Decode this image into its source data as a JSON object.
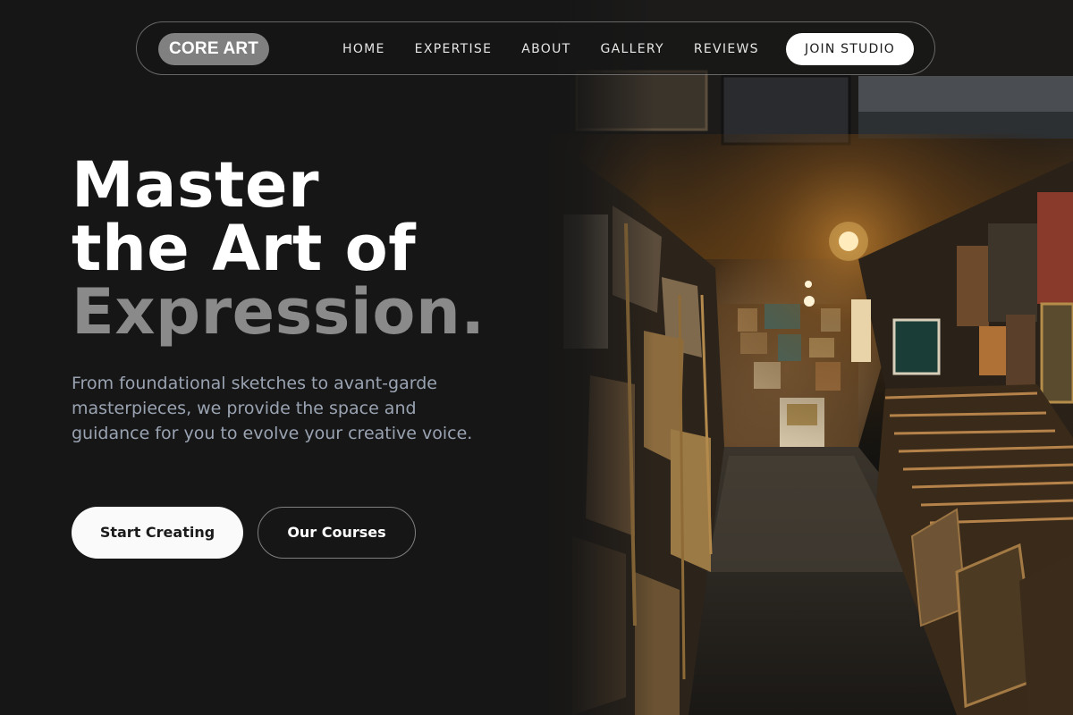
{
  "brand": {
    "logo_text": "CORE ART"
  },
  "nav": {
    "links": [
      "HOME",
      "EXPERTISE",
      "ABOUT",
      "GALLERY",
      "REVIEWS"
    ],
    "cta_label": "JOIN STUDIO"
  },
  "hero": {
    "headline_line1": "Master",
    "headline_line2": "the Art of",
    "headline_accent": "Expression.",
    "subtext": "From foundational sketches to avant-garde masterpieces, we provide the space and guidance for you to evolve your creative voice.",
    "primary_button": "Start Creating",
    "secondary_button": "Our Courses",
    "image_subject": "art studio storage corridor with stacked framed paintings"
  },
  "colors": {
    "background": "#161616",
    "accent_text": "#8a8a8a",
    "subtext": "#9aa3b2",
    "logo_bg": "#808080"
  }
}
